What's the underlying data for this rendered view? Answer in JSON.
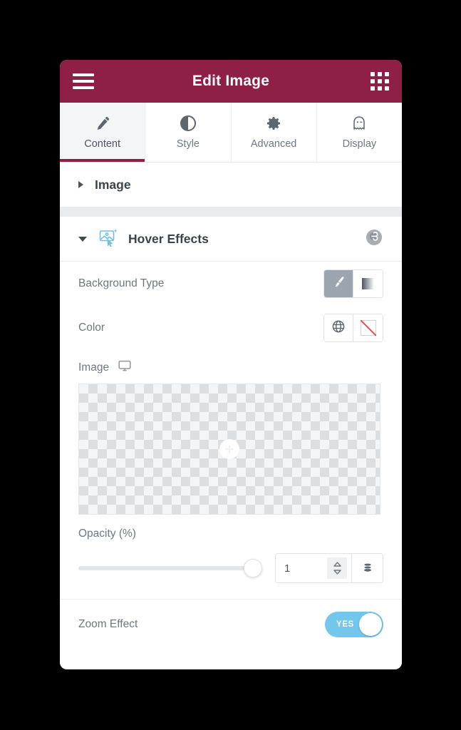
{
  "header": {
    "title": "Edit Image",
    "menu_icon": "hamburger-menu-icon",
    "grid_icon": "apps-grid-icon"
  },
  "tabs": [
    {
      "label": "Content",
      "icon": "pencil-icon",
      "active": true
    },
    {
      "label": "Style",
      "icon": "contrast-icon",
      "active": false
    },
    {
      "label": "Advanced",
      "icon": "gear-icon",
      "active": false
    },
    {
      "label": "Display",
      "icon": "ghost-icon",
      "active": false
    }
  ],
  "sections": {
    "image": {
      "title": "Image",
      "expanded": false
    },
    "hover_effects": {
      "title": "Hover Effects",
      "expanded": true,
      "badge_icon": "elementor-logo-icon"
    }
  },
  "controls": {
    "background_type": {
      "label": "Background Type",
      "options": [
        {
          "name": "classic",
          "icon": "paint-brush-icon",
          "selected": true
        },
        {
          "name": "gradient",
          "icon": "gradient-icon",
          "selected": false
        }
      ]
    },
    "color": {
      "label": "Color",
      "options": [
        {
          "name": "global-color",
          "icon": "globe-icon",
          "selected": false
        },
        {
          "name": "no-color",
          "icon": "no-color-icon",
          "selected": false
        }
      ]
    },
    "image": {
      "label": "Image",
      "device_icon": "desktop-monitor-icon",
      "upload_icon": "add-plus-icon",
      "value": ""
    },
    "opacity": {
      "label": "Opacity (%)",
      "value": "1",
      "slider_percent": 100,
      "units_icon": "database-stack-icon",
      "spinner_icon": "spinner-updown-icon"
    },
    "zoom_effect": {
      "label": "Zoom Effect",
      "state_label": "YES",
      "enabled": true
    }
  },
  "colors": {
    "header_bg": "#8e1f47",
    "accent": "#8e1f47",
    "toggle_on": "#74c7ec",
    "section_icon": "#6ec1e4",
    "text_muted": "#6d7882",
    "text_dark": "#3b444c",
    "no_color_line": "#e8453c"
  }
}
